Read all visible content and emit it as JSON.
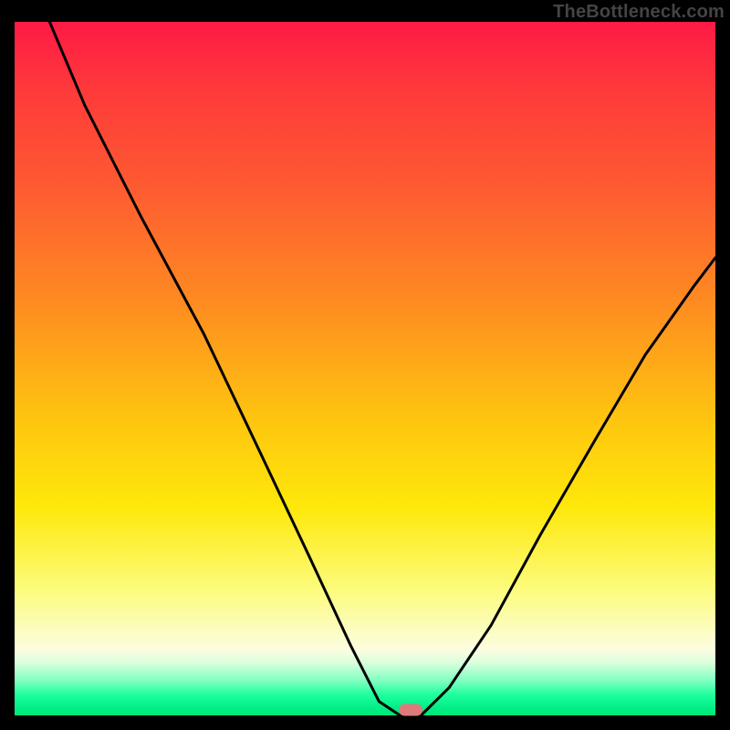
{
  "watermark": "TheBottleneck.com",
  "chart_data": {
    "type": "line",
    "title": "",
    "xlabel": "",
    "ylabel": "",
    "xlim": [
      0,
      100
    ],
    "ylim": [
      0,
      100
    ],
    "grid": false,
    "legend": false,
    "series": [
      {
        "name": "bottleneck-curve",
        "x": [
          5,
          10,
          18,
          27,
          35,
          42,
          48,
          52,
          55,
          58,
          62,
          68,
          75,
          83,
          90,
          97,
          100
        ],
        "y": [
          100,
          88,
          72,
          55,
          38,
          23,
          10,
          2,
          0,
          0,
          4,
          13,
          26,
          40,
          52,
          62,
          66
        ]
      }
    ],
    "marker": {
      "x": 56.5,
      "y": 0.8,
      "shape": "pill",
      "color": "#dd7b7b"
    },
    "background_gradient": {
      "stops": [
        {
          "pos": 0.0,
          "color": "#fe1a45"
        },
        {
          "pos": 0.4,
          "color": "#fe8a21"
        },
        {
          "pos": 0.7,
          "color": "#fee80a"
        },
        {
          "pos": 0.91,
          "color": "#fcfde0"
        },
        {
          "pos": 1.0,
          "color": "#00e676"
        }
      ]
    }
  }
}
